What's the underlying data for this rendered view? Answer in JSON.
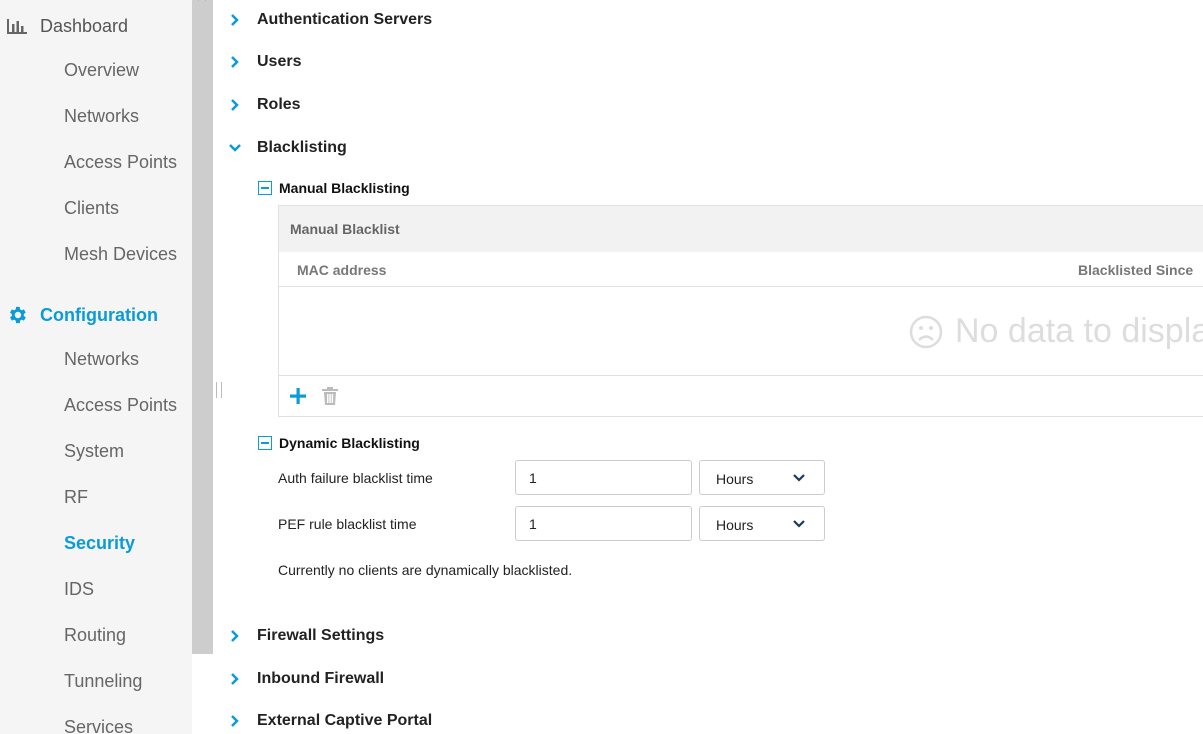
{
  "sidebar": {
    "dashboard": {
      "label": "Dashboard",
      "icon": "bar-chart-icon"
    },
    "dashboard_items": [
      {
        "label": "Overview"
      },
      {
        "label": "Networks"
      },
      {
        "label": "Access Points"
      },
      {
        "label": "Clients"
      },
      {
        "label": "Mesh Devices"
      }
    ],
    "configuration": {
      "label": "Configuration",
      "icon": "gear-icon"
    },
    "configuration_items": [
      {
        "label": "Networks"
      },
      {
        "label": "Access Points"
      },
      {
        "label": "System"
      },
      {
        "label": "RF"
      },
      {
        "label": "Security",
        "active": true
      },
      {
        "label": "IDS"
      },
      {
        "label": "Routing"
      },
      {
        "label": "Tunneling"
      },
      {
        "label": "Services"
      }
    ]
  },
  "sections_top": [
    {
      "title": "Authentication Servers",
      "expanded": false
    },
    {
      "title": "Users",
      "expanded": false
    },
    {
      "title": "Roles",
      "expanded": false
    },
    {
      "title": "Blacklisting",
      "expanded": true
    }
  ],
  "manual_blacklisting": {
    "title": "Manual Blacklisting",
    "table_caption": "Manual Blacklist",
    "columns": [
      "MAC address",
      "Blacklisted Since"
    ],
    "empty_text": "No data to displa"
  },
  "dynamic_blacklisting": {
    "title": "Dynamic Blacklisting",
    "auth_failure": {
      "label": "Auth failure blacklist time",
      "value": "1",
      "unit": "Hours"
    },
    "pef_rule": {
      "label": "PEF rule blacklist time",
      "value": "1",
      "unit": "Hours"
    },
    "note": "Currently no clients are dynamically blacklisted."
  },
  "sections_bottom": [
    {
      "title": "Firewall Settings",
      "expanded": false
    },
    {
      "title": "Inbound Firewall",
      "expanded": false
    },
    {
      "title": "External Captive Portal",
      "expanded": false
    }
  ],
  "colors": {
    "accent": "#0a9bd8",
    "sidebar_bg": "#f5f5f5",
    "scrollbar": "#cdcdcd"
  }
}
